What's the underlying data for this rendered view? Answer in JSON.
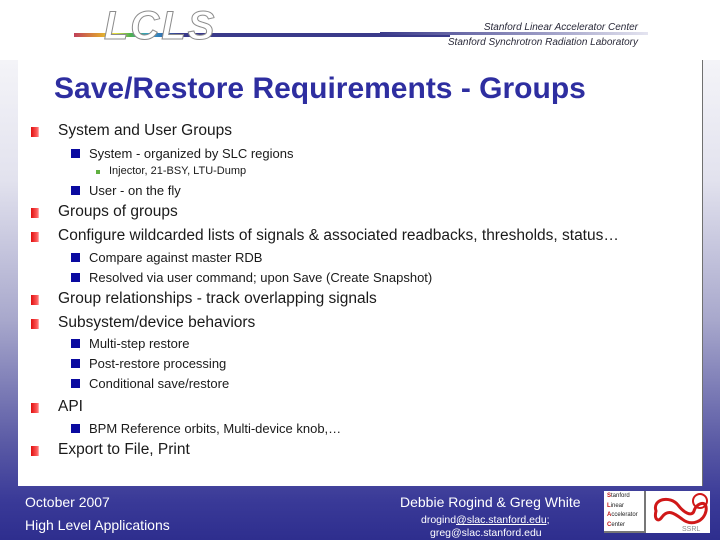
{
  "header": {
    "logo_text": "LCLS",
    "org_line_1": "Stanford Linear Accelerator Center",
    "org_line_2": "Stanford Synchrotron Radiation Laboratory"
  },
  "slide": {
    "title": "Save/Restore Requirements - Groups",
    "bullets": [
      {
        "level": 1,
        "text": "System and User Groups"
      },
      {
        "level": 2,
        "text": "System - organized by SLC regions"
      },
      {
        "level": 3,
        "text": "Injector, 21-BSY, LTU-Dump"
      },
      {
        "level": 2,
        "text": "User - on the fly"
      },
      {
        "level": 1,
        "text": "Groups of groups"
      },
      {
        "level": 1,
        "text": "Configure wildcarded lists of signals & associated readbacks, thresholds, status…"
      },
      {
        "level": 2,
        "text": "Compare against master RDB"
      },
      {
        "level": 2,
        "text": "Resolved via user command; upon Save (Create Snapshot)"
      },
      {
        "level": 1,
        "text": "Group relationships - track overlapping signals"
      },
      {
        "level": 1,
        "text": "Subsystem/device behaviors"
      },
      {
        "level": 2,
        "text": "Multi-step restore"
      },
      {
        "level": 2,
        "text": "Post-restore processing"
      },
      {
        "level": 2,
        "text": "Conditional save/restore"
      },
      {
        "level": 1,
        "text": "API"
      },
      {
        "level": 2,
        "text": "BPM Reference orbits, Multi-device knob,…"
      },
      {
        "level": 1,
        "text": "Export to File, Print"
      }
    ]
  },
  "footer": {
    "date": "October  2007",
    "topic": "High Level Applications",
    "authors": "Debbie Rogind & Greg White",
    "email_1_user": "drogind",
    "email_1_domain": "@slac.stanford.edu",
    "email_1_sep": ";",
    "email_2": "greg@slac.stanford.edu",
    "slac_logo_lines": [
      "Stanford",
      "Linear",
      "Accelerator",
      "Center"
    ],
    "slac_logo_caption": "SSRL"
  },
  "colors": {
    "title": "#2e2ea0",
    "bullet_level1": "#e01010",
    "bullet_level2": "#0a0aa0",
    "bullet_level3": "#60b040",
    "footer_bg": "#2e2e8e"
  }
}
